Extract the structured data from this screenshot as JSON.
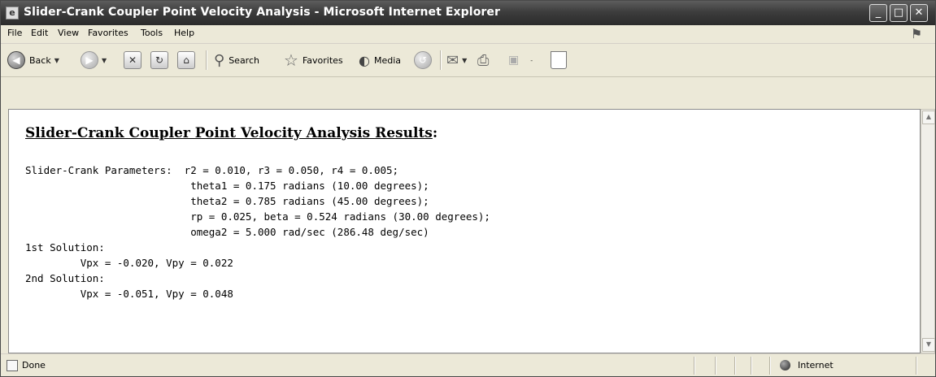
{
  "window": {
    "title": "Slider-Crank Coupler Point Velocity Analysis - Microsoft Internet Explorer",
    "minimize_symbol": "_",
    "maximize_symbol": "□",
    "close_symbol": "✕"
  },
  "menubar": {
    "items": [
      "File",
      "Edit",
      "View",
      "Favorites",
      "Tools",
      "Help"
    ]
  },
  "toolbar": {
    "back_label": "Back",
    "search_label": "Search",
    "favorites_label": "Favorites",
    "media_label": "Media"
  },
  "page": {
    "heading": "Slider-Crank Coupler Point Velocity Analysis Results",
    "heading_suffix": ":",
    "lines": [
      "Slider-Crank Parameters:  r2 = 0.010, r3 = 0.050, r4 = 0.005;",
      "                           theta1 = 0.175 radians (10.00 degrees);",
      "                           theta2 = 0.785 radians (45.00 degrees);",
      "                           rp = 0.025, beta = 0.524 radians (30.00 degrees);",
      "                           omega2 = 5.000 rad/sec (286.48 deg/sec)",
      "1st Solution:",
      "         Vpx = -0.020, Vpy = 0.022",
      "2nd Solution:",
      "         Vpx = -0.051, Vpy = 0.048"
    ]
  },
  "statusbar": {
    "status": "Done",
    "zone": "Internet"
  }
}
